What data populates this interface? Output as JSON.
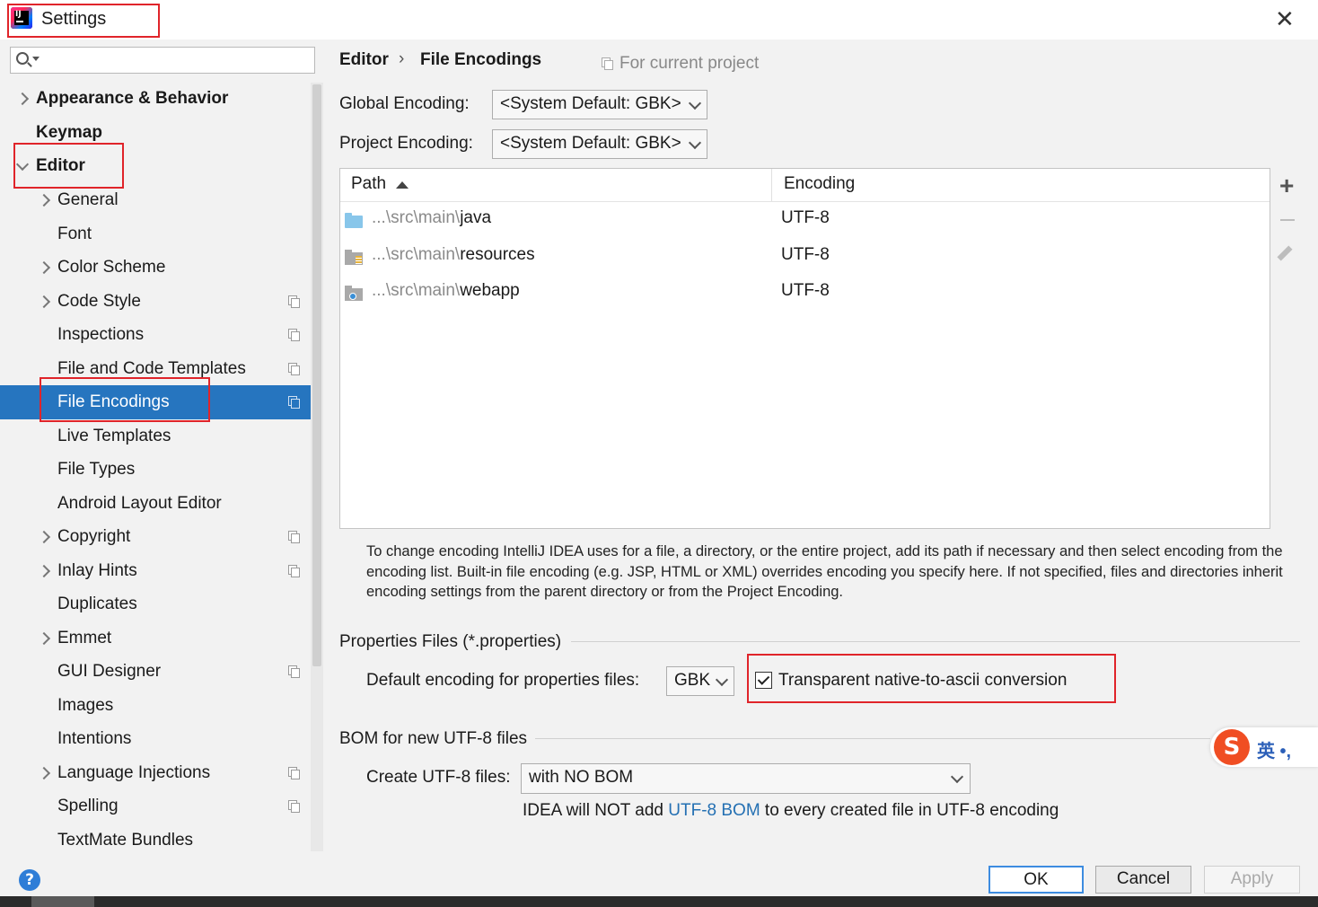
{
  "window": {
    "title": "Settings"
  },
  "search": {
    "placeholder": ""
  },
  "sidebar": {
    "items": [
      {
        "label": "Appearance & Behavior",
        "level": "top",
        "expandable": true,
        "expanded": false
      },
      {
        "label": "Keymap",
        "level": "top",
        "expandable": false
      },
      {
        "label": "Editor",
        "level": "top",
        "expandable": true,
        "expanded": true
      },
      {
        "label": "General",
        "level": "sub",
        "expandable": true
      },
      {
        "label": "Font",
        "level": "sub",
        "expandable": false
      },
      {
        "label": "Color Scheme",
        "level": "sub",
        "expandable": true
      },
      {
        "label": "Code Style",
        "level": "sub",
        "expandable": true,
        "project_icon": true
      },
      {
        "label": "Inspections",
        "level": "sub",
        "expandable": false,
        "project_icon": true
      },
      {
        "label": "File and Code Templates",
        "level": "sub",
        "expandable": false,
        "project_icon": true
      },
      {
        "label": "File Encodings",
        "level": "sub",
        "expandable": false,
        "project_icon": true,
        "selected": true
      },
      {
        "label": "Live Templates",
        "level": "sub",
        "expandable": false
      },
      {
        "label": "File Types",
        "level": "sub",
        "expandable": false
      },
      {
        "label": "Android Layout Editor",
        "level": "sub",
        "expandable": false
      },
      {
        "label": "Copyright",
        "level": "sub",
        "expandable": true,
        "project_icon": true
      },
      {
        "label": "Inlay Hints",
        "level": "sub",
        "expandable": true,
        "project_icon": true
      },
      {
        "label": "Duplicates",
        "level": "sub",
        "expandable": false
      },
      {
        "label": "Emmet",
        "level": "sub",
        "expandable": true
      },
      {
        "label": "GUI Designer",
        "level": "sub",
        "expandable": false,
        "project_icon": true
      },
      {
        "label": "Images",
        "level": "sub",
        "expandable": false
      },
      {
        "label": "Intentions",
        "level": "sub",
        "expandable": false
      },
      {
        "label": "Language Injections",
        "level": "sub",
        "expandable": true,
        "project_icon": true
      },
      {
        "label": "Spelling",
        "level": "sub",
        "expandable": false,
        "project_icon": true
      },
      {
        "label": "TextMate Bundles",
        "level": "sub",
        "expandable": false
      }
    ]
  },
  "breadcrumb": {
    "parent": "Editor",
    "separator": "›",
    "current": "File Encodings",
    "scope": "For current project"
  },
  "global_encoding": {
    "label": "Global Encoding:",
    "value": "<System Default: GBK>"
  },
  "project_encoding": {
    "label": "Project Encoding:",
    "value": "<System Default: GBK>"
  },
  "table": {
    "columns": [
      "Path",
      "Encoding"
    ],
    "rows": [
      {
        "path_prefix": "...\\src\\main\\",
        "path_name": "java",
        "encoding": "UTF-8",
        "icon": "folder-source-icon"
      },
      {
        "path_prefix": "...\\src\\main\\",
        "path_name": "resources",
        "encoding": "UTF-8",
        "icon": "folder-resources-icon"
      },
      {
        "path_prefix": "...\\src\\main\\",
        "path_name": "webapp",
        "encoding": "UTF-8",
        "icon": "folder-web-icon"
      }
    ]
  },
  "help_text": "To change encoding IntelliJ IDEA uses for a file, a directory, or the entire project, add its path if necessary and then select encoding from the encoding list. Built-in file encoding (e.g. JSP, HTML or XML) overrides encoding you specify here. If not specified, files and directories inherit encoding settings from the parent directory or from the Project Encoding.",
  "properties": {
    "section_title": "Properties Files (*.properties)",
    "default_label": "Default encoding for properties files:",
    "default_value": "GBK",
    "transparent_label": "Transparent native-to-ascii conversion",
    "transparent_checked": true
  },
  "bom": {
    "section_title": "BOM for new UTF-8 files",
    "create_label": "Create UTF-8 files:",
    "create_value": "with NO BOM",
    "note_prefix": "IDEA will NOT add ",
    "note_link": "UTF-8 BOM",
    "note_suffix": " to every created file in UTF-8 encoding"
  },
  "buttons": {
    "ok": "OK",
    "cancel": "Cancel",
    "apply": "Apply",
    "help": "?"
  },
  "ime": {
    "logo": "S",
    "text": "英 •,"
  },
  "colors": {
    "selection": "#2675bf",
    "highlight_box": "#e0242a",
    "link": "#2470b3",
    "ok_border": "#3d8ce0"
  }
}
